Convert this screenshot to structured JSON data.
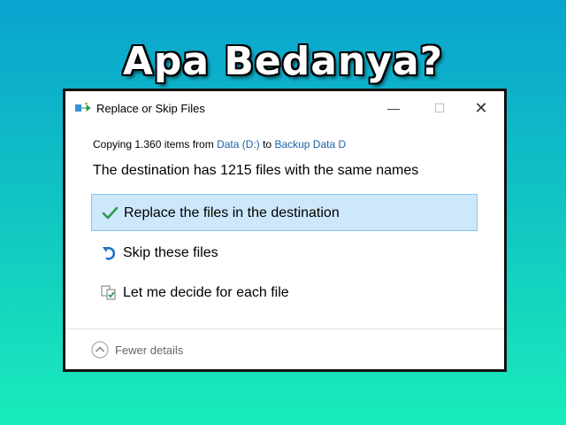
{
  "headline": "Apa Bedanya?",
  "dialog": {
    "title": "Replace or Skip Files",
    "window_buttons": {
      "minimize": "—",
      "maximize": "☐",
      "close": "✕"
    },
    "copy_prefix": "Copying 1.360 items from ",
    "source": "Data (D:)",
    "copy_to": " to ",
    "destination": "Backup Data D",
    "message": "The destination has 1215 files with the same names",
    "options": [
      {
        "label": "Replace the files in the destination",
        "icon": "checkmark-icon",
        "selected": true
      },
      {
        "label": "Skip these files",
        "icon": "skip-arrow-icon",
        "selected": false
      },
      {
        "label": "Let me decide for each file",
        "icon": "compare-files-icon",
        "selected": false
      }
    ],
    "footer": {
      "fewer_details": "Fewer details",
      "icon": "chevron-up-icon"
    }
  },
  "colors": {
    "link": "#1b63a8",
    "selected_bg": "#cde8fb",
    "selected_border": "#8dc4ec",
    "check_green": "#2e9a4f",
    "skip_blue": "#1f6fc5"
  }
}
